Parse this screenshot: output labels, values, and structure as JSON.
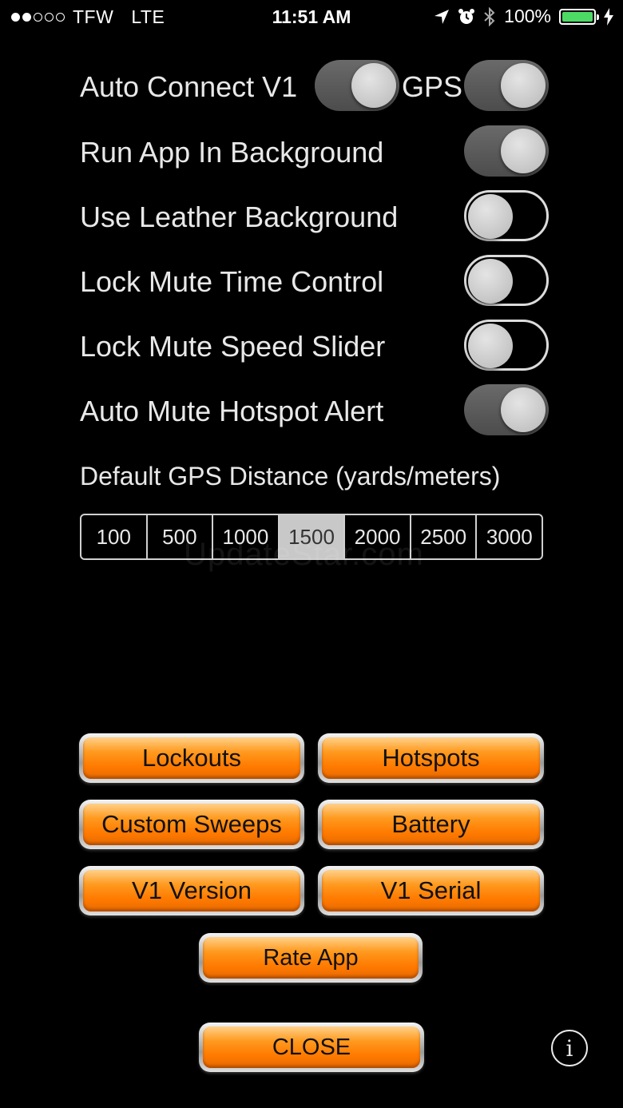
{
  "status_bar": {
    "carrier": "TFW",
    "network": "LTE",
    "time": "11:51 AM",
    "battery": "100%",
    "battery_color": "#4cd964",
    "icons": [
      "location-arrow-icon",
      "alarm-icon",
      "bluetooth-icon",
      "battery-icon",
      "charging-bolt-icon"
    ]
  },
  "settings": {
    "auto_connect": {
      "label": "Auto Connect V1",
      "on": true
    },
    "gps": {
      "label": "GPS",
      "on": true
    },
    "run_background": {
      "label": "Run App In Background",
      "on": true
    },
    "leather_background": {
      "label": "Use Leather Background",
      "on": false
    },
    "lock_mute_time": {
      "label": "Lock Mute Time Control",
      "on": false
    },
    "lock_mute_speed": {
      "label": "Lock Mute Speed Slider",
      "on": false
    },
    "auto_mute_hotspot": {
      "label": "Auto Mute Hotspot Alert",
      "on": true
    }
  },
  "gps_distance": {
    "label": "Default GPS Distance (yards/meters)",
    "options": [
      "100",
      "500",
      "1000",
      "1500",
      "2000",
      "2500",
      "3000"
    ],
    "selected": "1500"
  },
  "watermark": "UpdateStar.com",
  "buttons": {
    "lockouts": "Lockouts",
    "hotspots": "Hotspots",
    "custom_sweeps": "Custom Sweeps",
    "battery": "Battery",
    "v1_version": "V1 Version",
    "v1_serial": "V1 Serial",
    "rate_app": "Rate App",
    "close": "CLOSE"
  },
  "accent_color": "#ff8a00"
}
